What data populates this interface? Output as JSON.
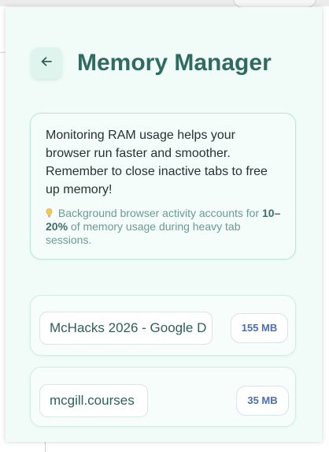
{
  "header": {
    "title": "Memory Manager",
    "back_icon": "arrow-left-icon"
  },
  "info": {
    "main_text": "Monitoring RAM usage helps your browser run faster and smoother. Remember to close inactive tabs to free up memory!",
    "tip_icon": "lightbulb-icon",
    "tip_prefix": " Background browser activity accounts for ",
    "tip_highlight": "10–20%",
    "tip_suffix": " of memory usage during heavy tab sessions."
  },
  "tabs": [
    {
      "name": "McHacks 2026 - Google D",
      "memory": "155 MB"
    },
    {
      "name": "mcgill.courses",
      "memory": "35 MB"
    }
  ],
  "colors": {
    "accent": "#2f6b60",
    "background": "#f1fcf8",
    "memory_text": "#4a6fb5"
  }
}
